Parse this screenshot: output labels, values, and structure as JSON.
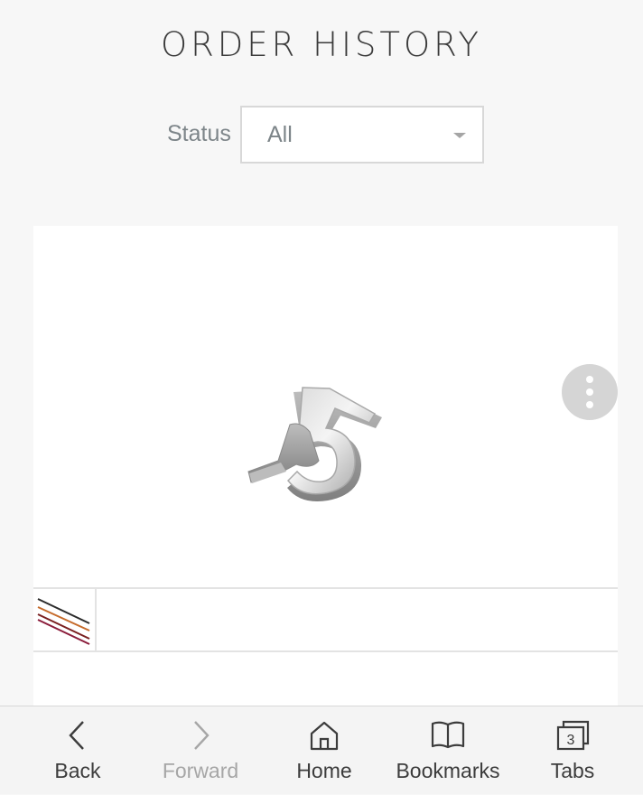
{
  "header": {
    "title": "ORDER HISTORY"
  },
  "filter": {
    "label": "Status",
    "selected": "All"
  },
  "order_card": {
    "product_image": "silver number 5 charm",
    "thumbnail": "multicolor cord strands"
  },
  "bottom_nav": {
    "back": "Back",
    "forward": "Forward",
    "home": "Home",
    "bookmarks": "Bookmarks",
    "tabs": "Tabs",
    "tabs_count": "3"
  }
}
